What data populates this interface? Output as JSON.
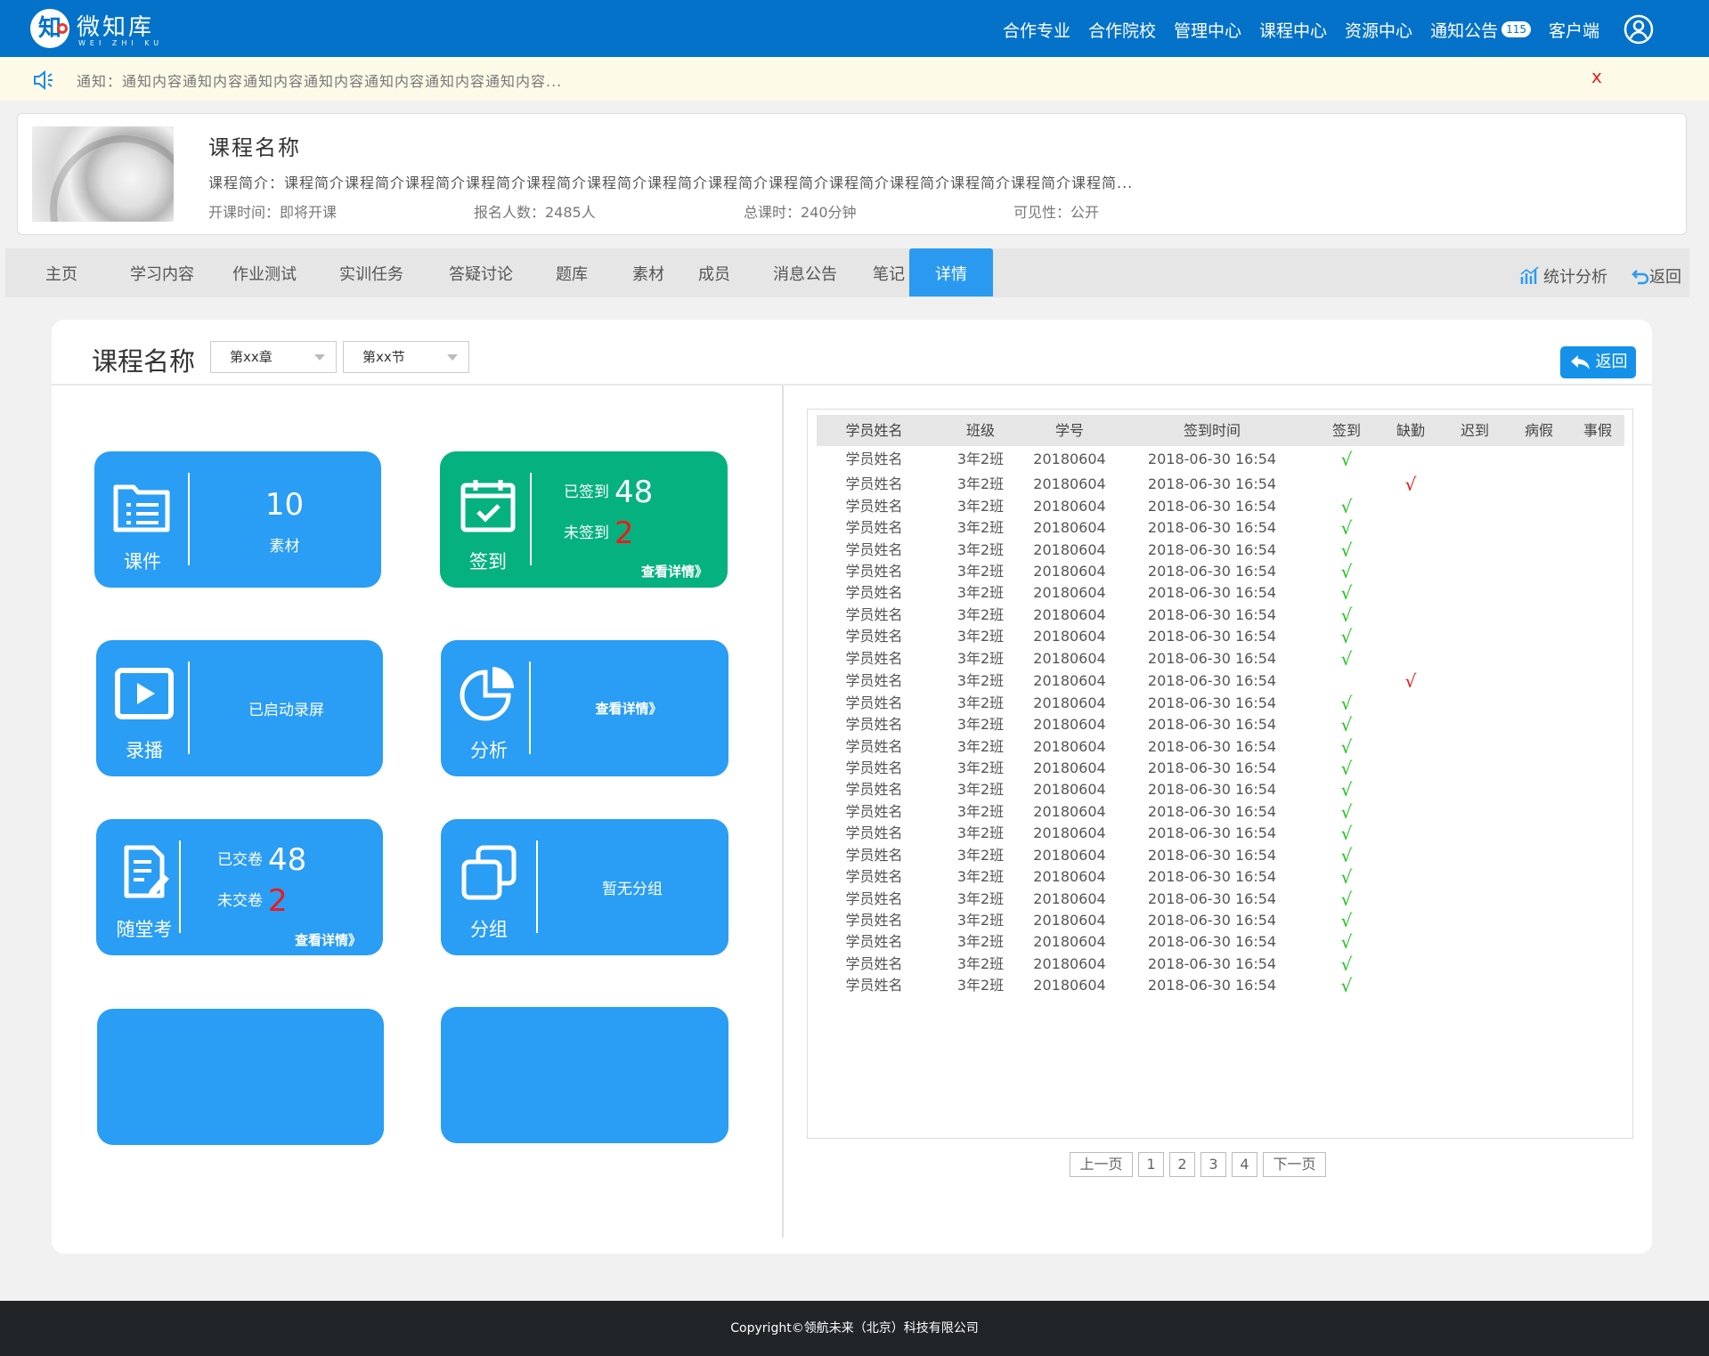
{
  "header": {
    "brand": "微知库",
    "brand_sub": "WEI ZHI KU",
    "logo_char": "知",
    "nav": [
      "合作专业",
      "合作院校",
      "管理中心",
      "课程中心",
      "资源中心",
      "通知公告",
      "客户端"
    ],
    "notice_badge": "115",
    "user_icon": "user-circle-icon"
  },
  "notice": {
    "text": "通知：通知内容通知内容通知内容通知内容通知内容通知内容通知内容...",
    "close": "x"
  },
  "course": {
    "name": "课程名称",
    "desc": "课程简介：课程简介课程简介课程简介课程简介课程简介课程简介课程简介课程简介课程简介课程简介课程简介课程简介课程简介课程简...",
    "start": "开课时间：即将开课",
    "enroll": "报名人数：2485人",
    "hours": "总课时：240分钟",
    "visibility": "可见性：公开"
  },
  "tabs": [
    "主页",
    "学习内容",
    "作业测试",
    "实训任务",
    "答疑讨论",
    "题库",
    "素材",
    "成员",
    "消息公告",
    "笔记",
    "详情"
  ],
  "tabs_active": "详情",
  "tab_actions": {
    "stats": "统计分析",
    "back": "返回"
  },
  "panel": {
    "title": "课程名称",
    "chapter": "第xx章",
    "section": "第xx节",
    "back": "返回"
  },
  "tiles": {
    "courseware": {
      "label": "课件",
      "count": "10",
      "unit": "素材"
    },
    "signin": {
      "label": "签到",
      "signed_label": "已签到",
      "signed": "48",
      "unsigned_label": "未签到",
      "unsigned": "2",
      "more": "查看详情》"
    },
    "record": {
      "label": "录播",
      "status": "已启动录屏"
    },
    "analysis": {
      "label": "分析",
      "more": "查看详情》"
    },
    "quiz": {
      "label": "随堂考",
      "submitted_label": "已交卷",
      "submitted": "48",
      "unsubmitted_label": "未交卷",
      "unsubmitted": "2",
      "more": "查看详情》"
    },
    "group": {
      "label": "分组",
      "status": "暂无分组"
    }
  },
  "table": {
    "columns": [
      "学员姓名",
      "班级",
      "学号",
      "签到时间",
      "签到",
      "缺勤",
      "迟到",
      "病假",
      "事假"
    ],
    "rows": [
      {
        "name": "学员姓名",
        "class": "3年2班",
        "id": "20180604",
        "time": "2018-06-30  16:54",
        "sign": "√",
        "absent": ""
      },
      {
        "name": "学员姓名",
        "class": "3年2班",
        "id": "20180604",
        "time": "2018-06-30  16:54",
        "sign": "",
        "absent": "√"
      },
      {
        "name": "学员姓名",
        "class": "3年2班",
        "id": "20180604",
        "time": "2018-06-30  16:54",
        "sign": "√",
        "absent": ""
      },
      {
        "name": "学员姓名",
        "class": "3年2班",
        "id": "20180604",
        "time": "2018-06-30  16:54",
        "sign": "√",
        "absent": ""
      },
      {
        "name": "学员姓名",
        "class": "3年2班",
        "id": "20180604",
        "time": "2018-06-30  16:54",
        "sign": "√",
        "absent": ""
      },
      {
        "name": "学员姓名",
        "class": "3年2班",
        "id": "20180604",
        "time": "2018-06-30  16:54",
        "sign": "√",
        "absent": ""
      },
      {
        "name": "学员姓名",
        "class": "3年2班",
        "id": "20180604",
        "time": "2018-06-30  16:54",
        "sign": "√",
        "absent": ""
      },
      {
        "name": "学员姓名",
        "class": "3年2班",
        "id": "20180604",
        "time": "2018-06-30  16:54",
        "sign": "√",
        "absent": ""
      },
      {
        "name": "学员姓名",
        "class": "3年2班",
        "id": "20180604",
        "time": "2018-06-30  16:54",
        "sign": "√",
        "absent": ""
      },
      {
        "name": "学员姓名",
        "class": "3年2班",
        "id": "20180604",
        "time": "2018-06-30  16:54",
        "sign": "√",
        "absent": ""
      },
      {
        "name": "学员姓名",
        "class": "3年2班",
        "id": "20180604",
        "time": "2018-06-30  16:54",
        "sign": "",
        "absent": "√"
      },
      {
        "name": "学员姓名",
        "class": "3年2班",
        "id": "20180604",
        "time": "2018-06-30  16:54",
        "sign": "√",
        "absent": ""
      },
      {
        "name": "学员姓名",
        "class": "3年2班",
        "id": "20180604",
        "time": "2018-06-30  16:54",
        "sign": "√",
        "absent": ""
      },
      {
        "name": "学员姓名",
        "class": "3年2班",
        "id": "20180604",
        "time": "2018-06-30  16:54",
        "sign": "√",
        "absent": ""
      },
      {
        "name": "学员姓名",
        "class": "3年2班",
        "id": "20180604",
        "time": "2018-06-30  16:54",
        "sign": "√",
        "absent": ""
      },
      {
        "name": "学员姓名",
        "class": "3年2班",
        "id": "20180604",
        "time": "2018-06-30  16:54",
        "sign": "√",
        "absent": ""
      },
      {
        "name": "学员姓名",
        "class": "3年2班",
        "id": "20180604",
        "time": "2018-06-30  16:54",
        "sign": "√",
        "absent": ""
      },
      {
        "name": "学员姓名",
        "class": "3年2班",
        "id": "20180604",
        "time": "2018-06-30  16:54",
        "sign": "√",
        "absent": ""
      },
      {
        "name": "学员姓名",
        "class": "3年2班",
        "id": "20180604",
        "time": "2018-06-30  16:54",
        "sign": "√",
        "absent": ""
      },
      {
        "name": "学员姓名",
        "class": "3年2班",
        "id": "20180604",
        "time": "2018-06-30  16:54",
        "sign": "√",
        "absent": ""
      },
      {
        "name": "学员姓名",
        "class": "3年2班",
        "id": "20180604",
        "time": "2018-06-30  16:54",
        "sign": "√",
        "absent": ""
      },
      {
        "name": "学员姓名",
        "class": "3年2班",
        "id": "20180604",
        "time": "2018-06-30  16:54",
        "sign": "√",
        "absent": ""
      },
      {
        "name": "学员姓名",
        "class": "3年2班",
        "id": "20180604",
        "time": "2018-06-30  16:54",
        "sign": "√",
        "absent": ""
      },
      {
        "name": "学员姓名",
        "class": "3年2班",
        "id": "20180604",
        "time": "2018-06-30  16:54",
        "sign": "√",
        "absent": ""
      },
      {
        "name": "学员姓名",
        "class": "3年2班",
        "id": "20180604",
        "time": "2018-06-30  16:54",
        "sign": "√",
        "absent": ""
      }
    ]
  },
  "pager": {
    "prev": "上一页",
    "pages": [
      "1",
      "2",
      "3",
      "4"
    ],
    "next": "下一页"
  },
  "footer": {
    "text": "Copyright©领航未来（北京）科技有限公司"
  },
  "colors": {
    "primary": "#0472c8",
    "tile_blue": "#2a9df4",
    "tile_green": "#06b180",
    "check_green": "#22c322",
    "mark_red": "#e01818"
  }
}
